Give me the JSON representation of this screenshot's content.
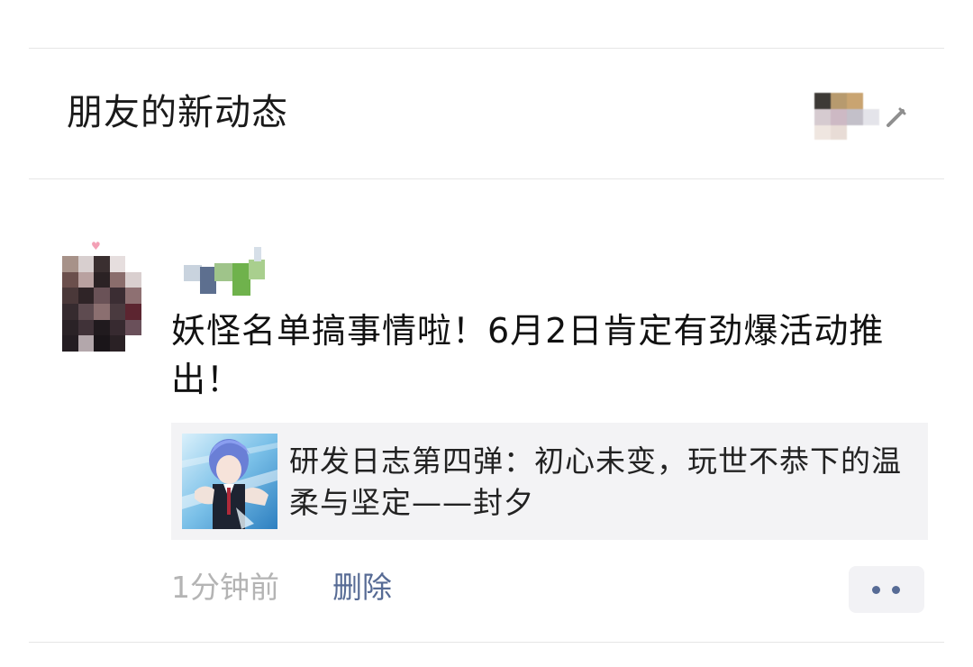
{
  "header": {
    "title": "朋友的新动态"
  },
  "post": {
    "text": "妖怪名单搞事情啦！6月2日肯定有劲爆活动推出！",
    "link_card": {
      "title": "研发日志第四弹：初心未变，玩世不恭下的温柔与坚定——封夕"
    },
    "time": "1分钟前",
    "delete_label": "删除"
  },
  "colors": {
    "link_blue": "#576b95",
    "meta_gray": "#b4b4b4",
    "card_bg": "#f3f3f5"
  },
  "icons": {
    "chevron": "pencil-arrow-icon",
    "more": "more-dots-icon",
    "heart": "heart-icon"
  }
}
